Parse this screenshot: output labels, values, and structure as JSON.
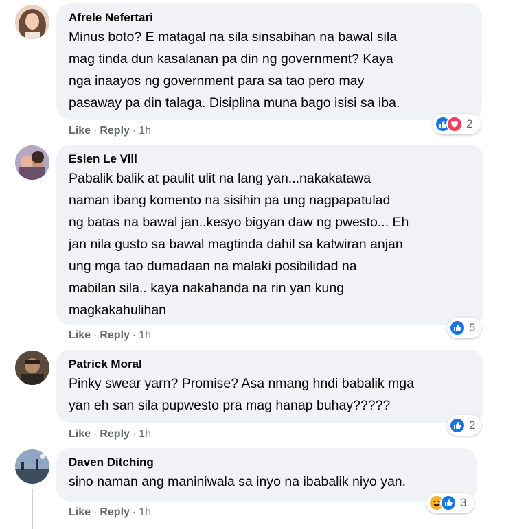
{
  "comments": [
    {
      "author": "Afrele Nefertari",
      "text": "Minus boto? E matagal na sila sinsabihan na bawal sila\nmag tinda dun kasalanan pa din ng government? Kaya\nnga inaayos ng government para sa tao pero may\npasaway pa din talaga. Disiplina muna bago isisi sa iba.",
      "like_label": "Like",
      "reply_label": "Reply",
      "time": "1h",
      "reactions": [
        "like",
        "love"
      ],
      "reaction_count": "2"
    },
    {
      "author": "Esien Le Vill",
      "text": "Pabalik balik at paulit ulit na lang yan...nakakatawa\nnaman ibang komento na sisihin pa ung nagpapatulad\nng batas na bawal jan..kesyo bigyan daw ng pwesto... Eh\njan nila gusto sa bawal magtinda dahil sa katwiran anjan\nung mga tao dumadaan na malaki posibilidad na\nmabilan sila.. kaya nakahanda na rin yan kung\nmagkakahulihan",
      "like_label": "Like",
      "reply_label": "Reply",
      "time": "1h",
      "reactions": [
        "like"
      ],
      "reaction_count": "5"
    },
    {
      "author": "Patrick Moral",
      "text": "Pinky swear yarn? Promise? Asa nmang hndi babalik mga\nyan eh san sila pupwesto pra mag hanap buhay?????",
      "like_label": "Like",
      "reply_label": "Reply",
      "time": "1h",
      "reactions": [
        "like"
      ],
      "reaction_count": "2"
    },
    {
      "author": "Daven Ditching",
      "text": "sino naman ang maniniwala sa inyo na ibabalik niyo yan.",
      "like_label": "Like",
      "reply_label": "Reply",
      "time": "1h",
      "reactions": [
        "haha",
        "like"
      ],
      "reaction_count": "3"
    }
  ],
  "separator": "·",
  "colors": {
    "bubble": "#f0f2f5",
    "meta_text": "#65676b",
    "like_blue": "#1b74e4",
    "love_red": "#f33e58",
    "haha_yellow": "#f7b125"
  }
}
